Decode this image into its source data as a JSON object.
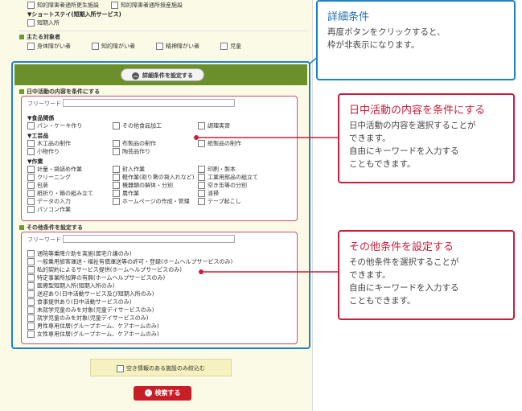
{
  "top_section": {
    "row1": [
      "知的障害者通所更生施設",
      "知的障害者通所授産施設"
    ],
    "short_stay": "▼ショートステイ(短期入所サービス)",
    "short_stay_item": "短期入所",
    "main_target_title": "主たる対象者",
    "targets": [
      "身体障がい者",
      "知的障がい者",
      "精神障がい者",
      "児童"
    ]
  },
  "detail_button": "詳細条件を設定する",
  "daytime": {
    "title": "日中活動の内容を条件にする",
    "keyword_label": "フリーワード",
    "food_title": "▼食品関係",
    "food": [
      "パン・ケーキ作り",
      "その他食品加工",
      "調理実習"
    ],
    "craft_title": "▼工芸品",
    "craft": [
      "木工品の制作",
      "布製品の制作",
      "紙製品の制作",
      "小物作り",
      "陶芸品作り"
    ],
    "work_title": "▼作業",
    "work": [
      "計量・袋詰め作業",
      "封入作業",
      "印刷・製本",
      "クリーニング",
      "軽作業(割り箸の袋入れなど)",
      "工業用部品の組立て",
      "包装",
      "機器類の解体・分別",
      "空き缶等の分別",
      "紙折り・箱の組み立て",
      "農作業",
      "清掃",
      "データの入力",
      "ホームページの作成・管理",
      "テープ起こし",
      "パソコン作業"
    ]
  },
  "other": {
    "title": "その他条件を設定する",
    "keyword_label": "フリーワード",
    "items": [
      "通院等乗降介助を実施(居宅介護のみ)",
      "一般乗用旅客運送・福祉有償運送等の許可・登録(ホームヘルプサービスのみ)",
      "私的契約によるサービス提供(ホームヘルプサービスのみ)",
      "特定事業所加算の有無(ホームヘルプサービスのみ)",
      "医療型短期入所(短期入所のみ)",
      "送迎あり(日中活動サービス及び短期入所のみ)",
      "食事提供あり(日中活動サービスのみ)",
      "未就学児童のみを対象(児童デイサービスのみ)",
      "就学児童のみを対象(児童デイサービスのみ)",
      "男性専用住居(グループホーム、ケアホームのみ)",
      "女性専用住居(グループホーム、ケアホームのみ)"
    ]
  },
  "availability_checkbox": "空き情報のある施設のみ絞込む",
  "search_button": "検索する",
  "callouts": {
    "detail": {
      "title": "詳細条件",
      "body": "再度ボタンをクリックすると、\n枠が非表示になります。"
    },
    "daytime": {
      "title": "日中活動の内容を条件にする",
      "body": "日中活動の内容を選択することが\nできます。\n自由にキーワードを入力する\nこともできます。"
    },
    "other": {
      "title": "その他条件を設定する",
      "body": "その他条件を選択することが\nできます。\n自由にキーワードを入力する\nこともできます。"
    }
  },
  "colors": {
    "accent_blue": "#1e82c8",
    "accent_red": "#c81e3c",
    "band_green": "#6b8f2a"
  }
}
